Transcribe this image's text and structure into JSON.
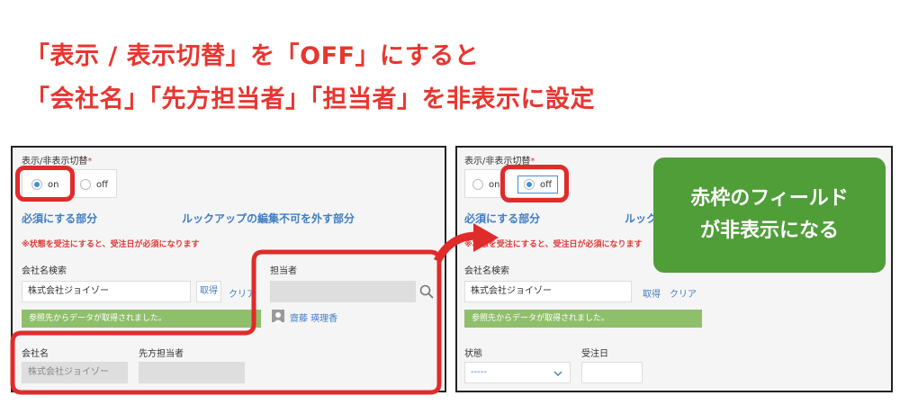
{
  "heading": {
    "line1": "「表示 / 表示切替」を「OFF」にすると",
    "line2": "「会社名」「先方担当者」「担当者」を非表示に設定"
  },
  "left": {
    "toggle_label": "表示/非表示切替",
    "required_mark": "*",
    "option_on": "on",
    "option_off": "off",
    "selected": "on",
    "required_section": "必須にする部分",
    "lookup_section": "ルックアップの編集不可を外す部分",
    "warning": "※状態を受注にすると、受注日が必須になります",
    "company_search_label": "会社名検索",
    "company_search_value": "株式会社ジョイゾー",
    "get_button": "取得",
    "clear_link": "クリア",
    "fetched_message": "参照先からデータが取得されました。",
    "person_label": "担当者",
    "person_value": "齋藤 瑛理香",
    "company_name_label": "会社名",
    "company_name_value": "株式会社ジョイゾー",
    "client_contact_label": "先方担当者"
  },
  "right": {
    "toggle_label": "表示/非表示切替",
    "required_mark": "*",
    "option_on": "on",
    "option_off": "off",
    "selected": "off",
    "required_section": "必須にする部分",
    "lookup_section_partial": "ルック",
    "warning_partial": "※状態を受注にすると、受注日が必須になります",
    "company_search_label": "会社名検索",
    "company_search_value": "株式会社ジョイゾー",
    "get_button": "取得",
    "clear_link": "クリア",
    "fetched_message": "参照先からデータが取得されました。",
    "status_label": "状態",
    "status_value": "-----",
    "order_date_label": "受注日"
  },
  "callout": {
    "line1": "赤枠のフィールド",
    "line2": "が非表示になる"
  },
  "colors": {
    "heading_red": "#e8362f",
    "highlight_red": "#e02b2b",
    "callout_green": "#4f9e38",
    "link_blue": "#3f7ec4",
    "message_green": "#8fbf6b"
  }
}
